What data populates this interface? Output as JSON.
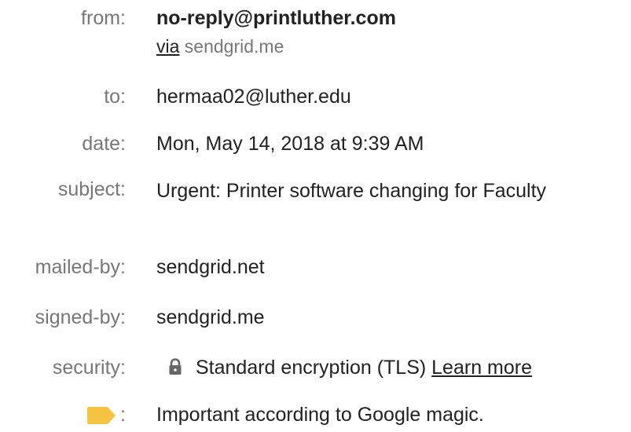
{
  "details": {
    "from": {
      "label": "from:",
      "sender": "no-reply@printluther.com",
      "via_word": "via",
      "via_domain": "sendgrid.me"
    },
    "to": {
      "label": "to:",
      "value": "hermaa02@luther.edu"
    },
    "date": {
      "label": "date:",
      "value": "Mon, May 14, 2018 at 9:39 AM"
    },
    "subject": {
      "label": "subject:",
      "value": "Urgent: Printer software changing for Faculty"
    },
    "mailed_by": {
      "label": "mailed-by:",
      "value": "sendgrid.net"
    },
    "signed_by": {
      "label": "signed-by:",
      "value": "sendgrid.me"
    },
    "security": {
      "label": "security:",
      "icon": "lock-icon",
      "value": "Standard encryption (TLS)",
      "link": "Learn more"
    },
    "importance": {
      "icon": "importance-marker-icon",
      "icon_color": "#f6c443",
      "colon": ":",
      "value": "Important according to Google magic."
    }
  }
}
